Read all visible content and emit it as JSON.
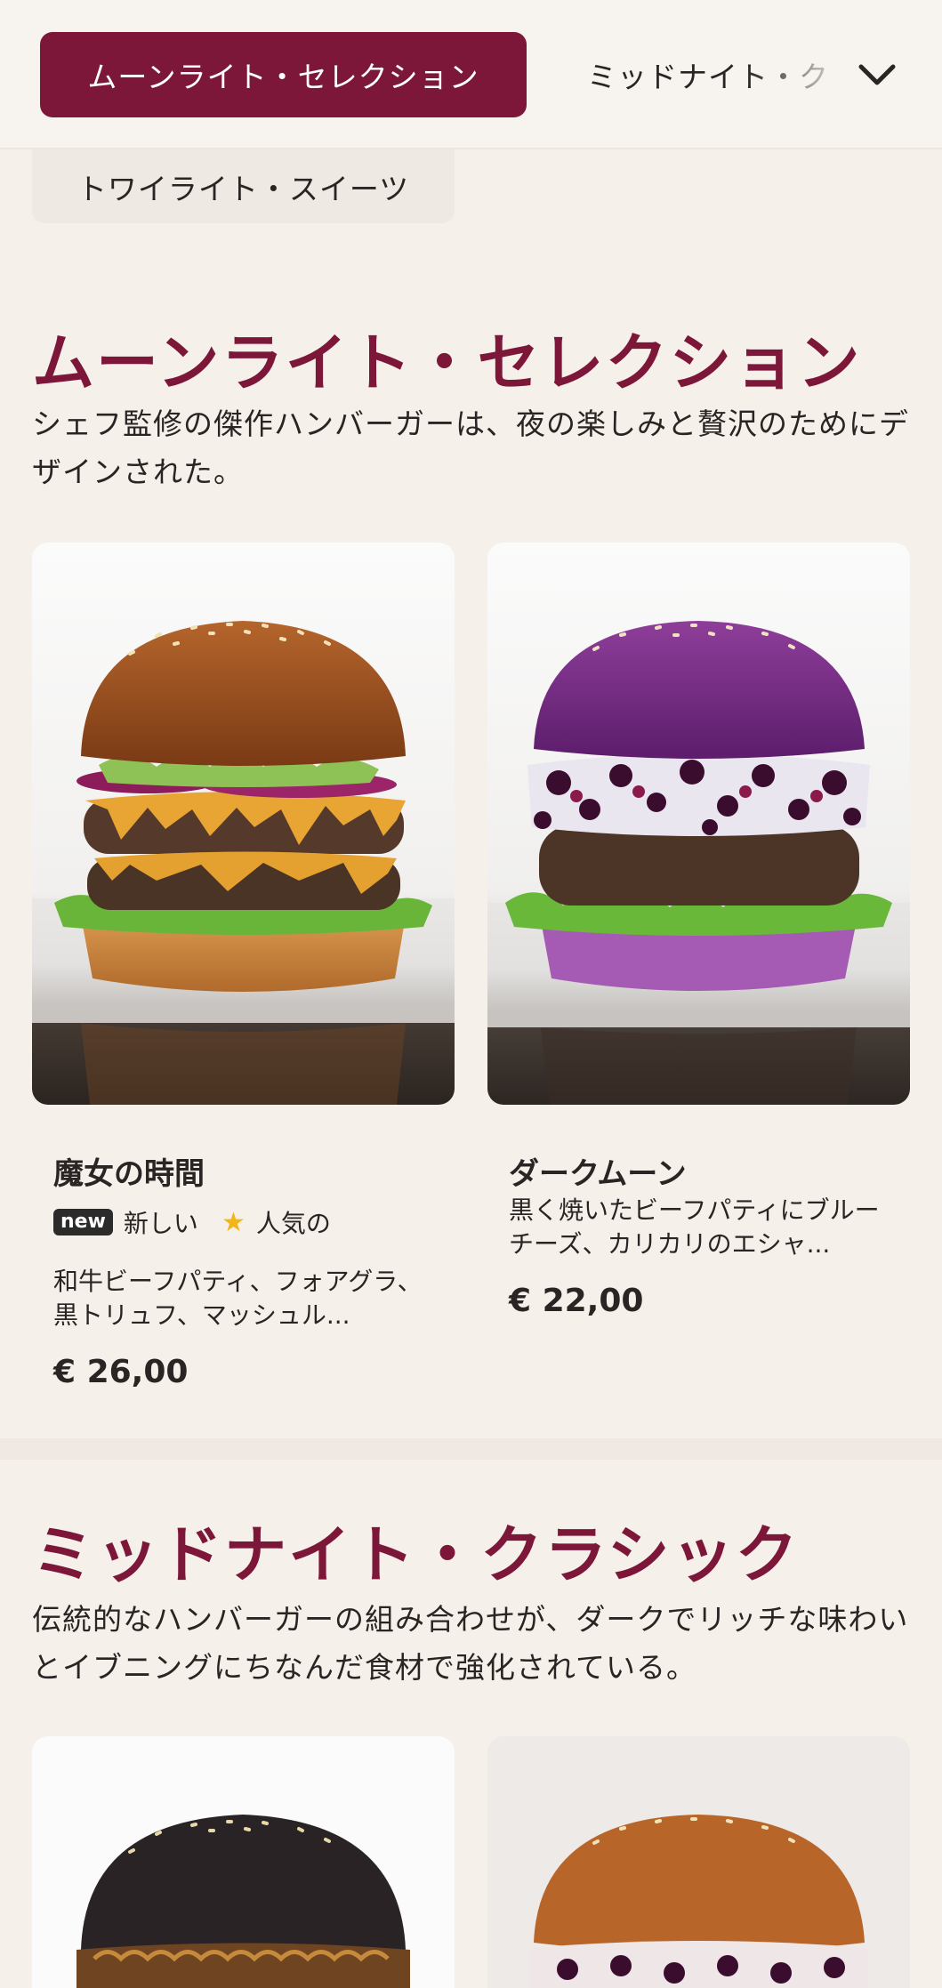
{
  "nav": {
    "active_category": "ムーンライト・セレクション",
    "next_category": "ミッドナイト・ク",
    "second_row_category": "トワイライト・スイーツ",
    "expand_icon": "chevron-down-icon"
  },
  "sections": [
    {
      "title": "ムーンライト・セレクション",
      "description": "シェフ監修の傑作ハンバーガーは、夜の楽しみと贅沢のためにデザインされた。",
      "items": [
        {
          "name": "魔女の時間",
          "badge": "new",
          "tag_new": "新しい",
          "tag_popular": "人気の",
          "description": "和牛ビーフパティ、フォアグラ、黒トリュフ、マッシュル...",
          "price": "€ 26,00"
        },
        {
          "name": "ダークムーン",
          "description": "黒く焼いたビーフパティにブルーチーズ、カリカリのエシャ...",
          "price": "€ 22,00"
        }
      ]
    },
    {
      "title": "ミッドナイト・クラシック",
      "description": "伝統的なハンバーガーの組み合わせが、ダークでリッチな味わいとイブニングにちなんだ食材で強化されている。"
    }
  ],
  "colors": {
    "accent": "#7d1739",
    "background": "#f5f1ea",
    "star": "#f2b51b"
  }
}
